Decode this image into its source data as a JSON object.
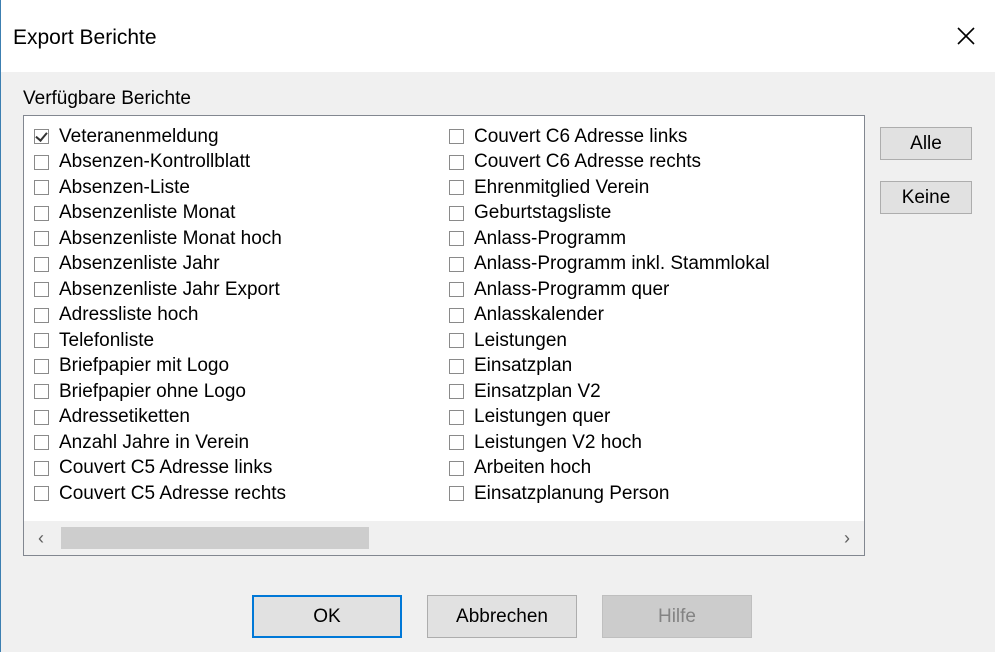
{
  "window": {
    "title": "Export Berichte",
    "close_icon": "close-icon"
  },
  "group_label": "Verfügbare Berichte",
  "reports_col1": [
    {
      "label": "Veteranenmeldung",
      "checked": true
    },
    {
      "label": "Absenzen-Kontrollblatt",
      "checked": false
    },
    {
      "label": "Absenzen-Liste",
      "checked": false
    },
    {
      "label": "Absenzenliste Monat",
      "checked": false
    },
    {
      "label": "Absenzenliste Monat hoch",
      "checked": false
    },
    {
      "label": "Absenzenliste Jahr",
      "checked": false
    },
    {
      "label": "Absenzenliste Jahr Export",
      "checked": false
    },
    {
      "label": "Adressliste hoch",
      "checked": false
    },
    {
      "label": "Telefonliste",
      "checked": false
    },
    {
      "label": "Briefpapier mit Logo",
      "checked": false
    },
    {
      "label": "Briefpapier ohne Logo",
      "checked": false
    },
    {
      "label": "Adressetiketten",
      "checked": false
    },
    {
      "label": "Anzahl Jahre in Verein",
      "checked": false
    },
    {
      "label": "Couvert C5 Adresse links",
      "checked": false
    },
    {
      "label": "Couvert C5 Adresse rechts",
      "checked": false
    }
  ],
  "reports_col2": [
    {
      "label": "Couvert C6 Adresse links",
      "checked": false
    },
    {
      "label": "Couvert C6 Adresse rechts",
      "checked": false
    },
    {
      "label": "Ehrenmitglied Verein",
      "checked": false
    },
    {
      "label": "Geburtstagsliste",
      "checked": false
    },
    {
      "label": "Anlass-Programm",
      "checked": false
    },
    {
      "label": "Anlass-Programm inkl. Stammlokal",
      "checked": false
    },
    {
      "label": "Anlass-Programm quer",
      "checked": false
    },
    {
      "label": "Anlasskalender",
      "checked": false
    },
    {
      "label": "Leistungen",
      "checked": false
    },
    {
      "label": "Einsatzplan",
      "checked": false
    },
    {
      "label": "Einsatzplan V2",
      "checked": false
    },
    {
      "label": "Leistungen quer",
      "checked": false
    },
    {
      "label": "Leistungen V2 hoch",
      "checked": false
    },
    {
      "label": "Arbeiten hoch",
      "checked": false
    },
    {
      "label": "Einsatzplanung Person",
      "checked": false
    }
  ],
  "side_buttons": {
    "all": "Alle",
    "none": "Keine"
  },
  "footer_buttons": {
    "ok": "OK",
    "cancel": "Abbrechen",
    "help": "Hilfe",
    "help_enabled": false
  },
  "scrollbar": {
    "left_arrow": "‹",
    "right_arrow": "›"
  },
  "colors": {
    "dialog_bg": "#f0f0f0",
    "default_button_border": "#0078d7",
    "disabled_text": "#838383"
  }
}
